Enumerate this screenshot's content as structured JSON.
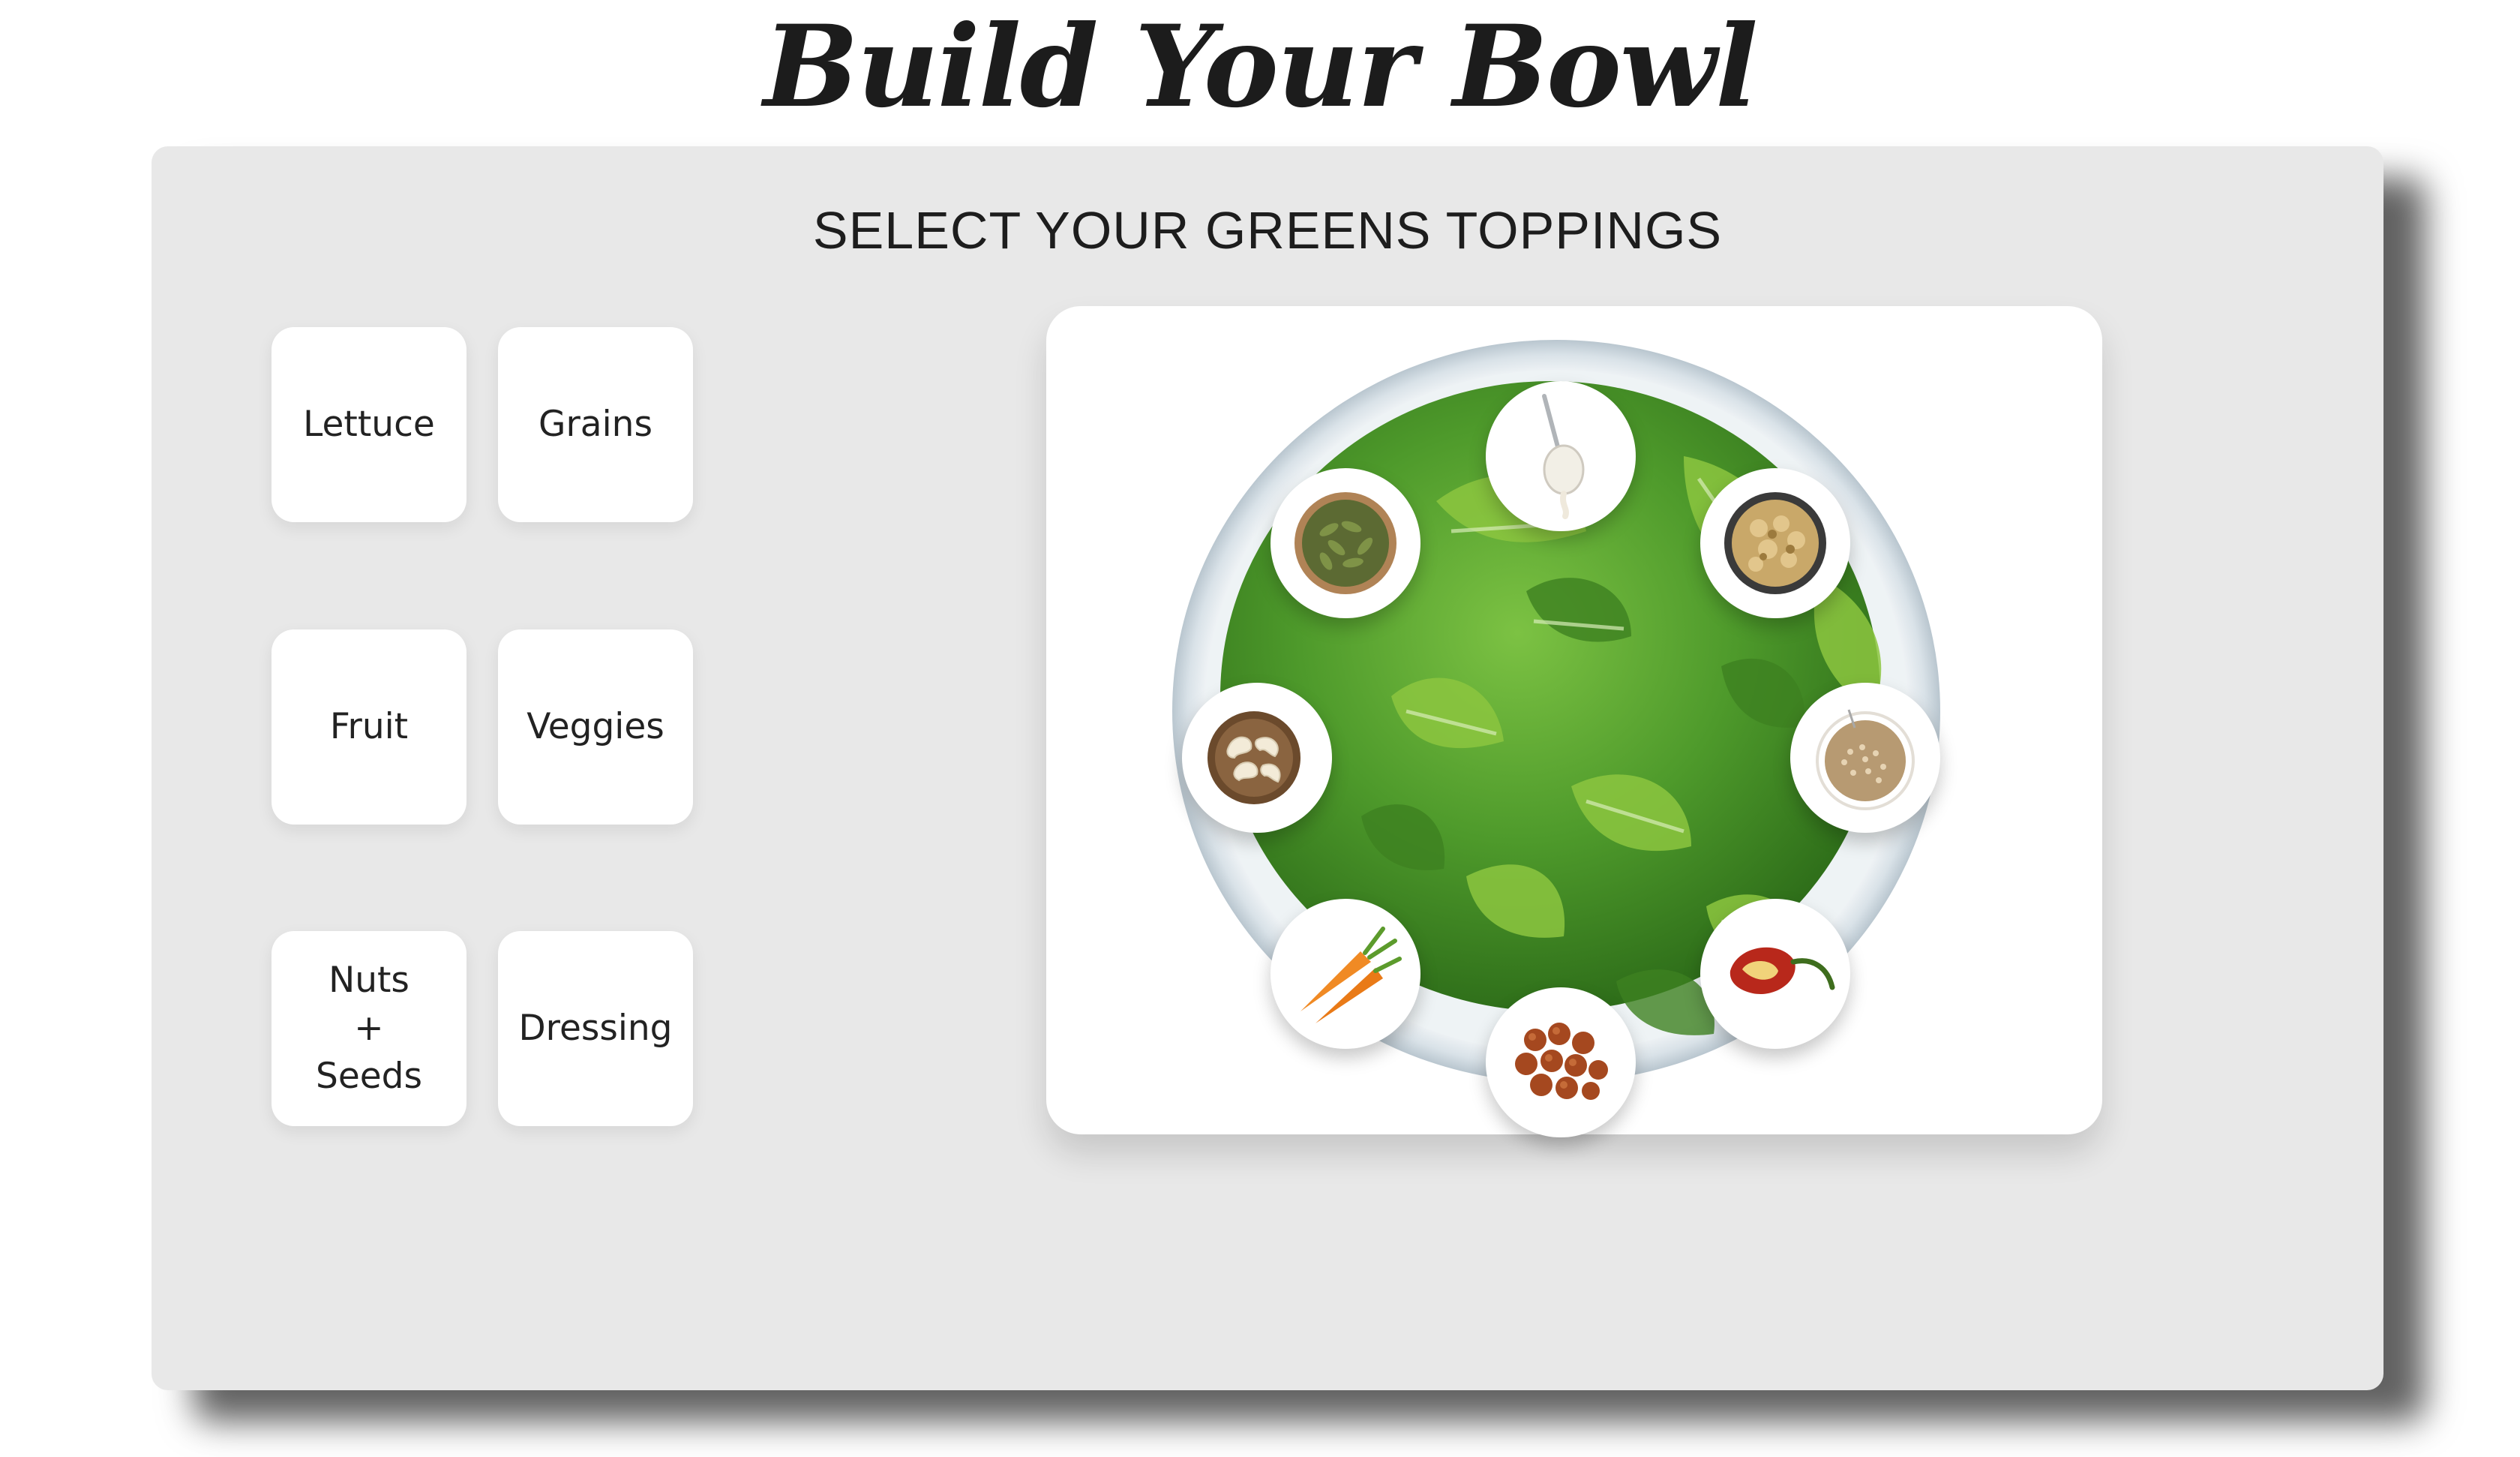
{
  "header": {
    "title": "Build Your Bowl"
  },
  "builder": {
    "heading": "SELECT YOUR GREENS TOPPINGS",
    "categories": [
      {
        "id": "lettuce",
        "label": "Lettuce"
      },
      {
        "id": "grains",
        "label": "Grains"
      },
      {
        "id": "fruit",
        "label": "Fruit"
      },
      {
        "id": "veggies",
        "label": "Veggies"
      },
      {
        "id": "nuts-seeds",
        "label_lines": [
          "Nuts",
          "+",
          "Seeds"
        ]
      },
      {
        "id": "dressing",
        "label": "Dressing"
      }
    ],
    "bowl": {
      "base": "lettuce-greens-bowl",
      "toppings": [
        {
          "name": "dressing-spoon-icon"
        },
        {
          "name": "chopped-walnuts-icon"
        },
        {
          "name": "quinoa-grains-icon"
        },
        {
          "name": "red-chili-pepper-icon"
        },
        {
          "name": "roasted-chickpeas-icon"
        },
        {
          "name": "carrots-icon"
        },
        {
          "name": "cashews-icon"
        },
        {
          "name": "pumpkin-seeds-icon"
        }
      ]
    }
  },
  "colors": {
    "panel_bg": "#e8e8e8",
    "card_bg": "#ffffff",
    "lettuce_dark": "#3f8a22",
    "lettuce_light": "#8cc63f",
    "text": "#222222"
  }
}
